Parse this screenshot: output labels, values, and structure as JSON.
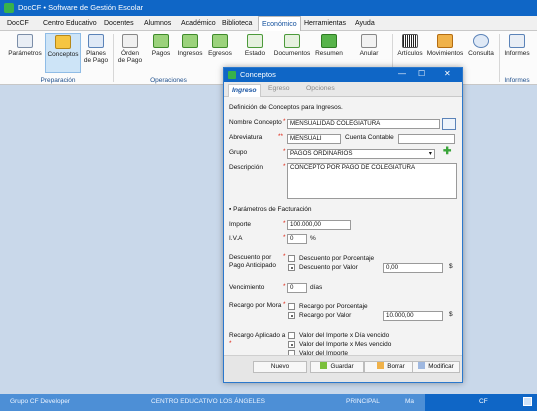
{
  "app": {
    "title": "DocCF • Software de Gestión Escolar"
  },
  "menu": [
    "DocCF",
    "Centro Educativo",
    "Docentes",
    "Alumnos",
    "Académico",
    "Biblioteca",
    "Económico",
    "Herramientas",
    "Ayuda"
  ],
  "ribbon": {
    "groups": {
      "preparacion": "Preparación",
      "operaciones": "Operaciones",
      "informes": "Informes"
    },
    "buttons": {
      "parametros": "Parámetros",
      "conceptos": "Conceptos",
      "planes1": "Planes",
      "planes2": "de Pago",
      "orden1": "Órden",
      "orden2": "de Pago",
      "pagos": "Pagos",
      "ingresos": "Ingresos",
      "egresos": "Egresos",
      "estado": "Estado",
      "documentos": "Documentos",
      "resumen": "Resumen",
      "anular": "Anular",
      "articulos": "Artículos",
      "movimientos": "Movimientos",
      "consulta": "Consulta",
      "informes": "Informes"
    }
  },
  "statusbar": {
    "user": "Grupo CF Developer",
    "centro": "CENTRO EDUCATIVO LOS ÁNGELES",
    "sede": "PRINCIPAL",
    "ma": "Ma",
    "cf": "CF"
  },
  "dialog": {
    "title": "Conceptos",
    "tabs": {
      "ingreso": "Ingreso",
      "egreso": "Egreso",
      "opciones": "Opciones"
    },
    "heading": "Definición de Conceptos para Ingresos.",
    "labels": {
      "nombre": "Nombre Concepto",
      "abreviatura": "Abreviatura",
      "cuenta": "Cuenta Contable",
      "grupo": "Grupo",
      "descripcion": "Descripción",
      "parametros": "Parámetros de Facturación",
      "importe": "Importe",
      "iva": "I.V.A",
      "descuento1": "Descuento por",
      "descuento2": "Pago Anticipado",
      "vencimiento": "Vencimiento",
      "recargo": "Recargo por Mora",
      "aplicado": "Recargo Aplicado a",
      "dias": "días",
      "pct": "%",
      "dollar1": "$",
      "dollar2": "$"
    },
    "values": {
      "nombre": "MENSUALIDAD COLEGIATURA",
      "abreviatura": "MENSUALI",
      "cuenta": "",
      "grupo": "PAGOS ORDINARIOS",
      "descripcion": "CONCEPTO POR PAGO DE COLEGIATURA",
      "importe": "100.000,00",
      "iva": "0",
      "descuentoValor": "0,00",
      "vencimiento": "0",
      "recargoValor": "10.000,00"
    },
    "options": {
      "descPorcentaje": "Descuento por Porcentaje",
      "descValor": "Descuento por Valor",
      "recPorcentaje": "Recargo por Porcentaje",
      "recValor": "Recargo por Valor",
      "aplDia": "Valor del Importe x Día vencido",
      "aplMes": "Valor del Importe x Mes vencido",
      "aplImporte": "Valor del Importe"
    },
    "buttons": {
      "nuevo": "Nuevo",
      "guardar": "Guardar",
      "borrar": "Borrar",
      "modificar": "Modificar"
    }
  }
}
